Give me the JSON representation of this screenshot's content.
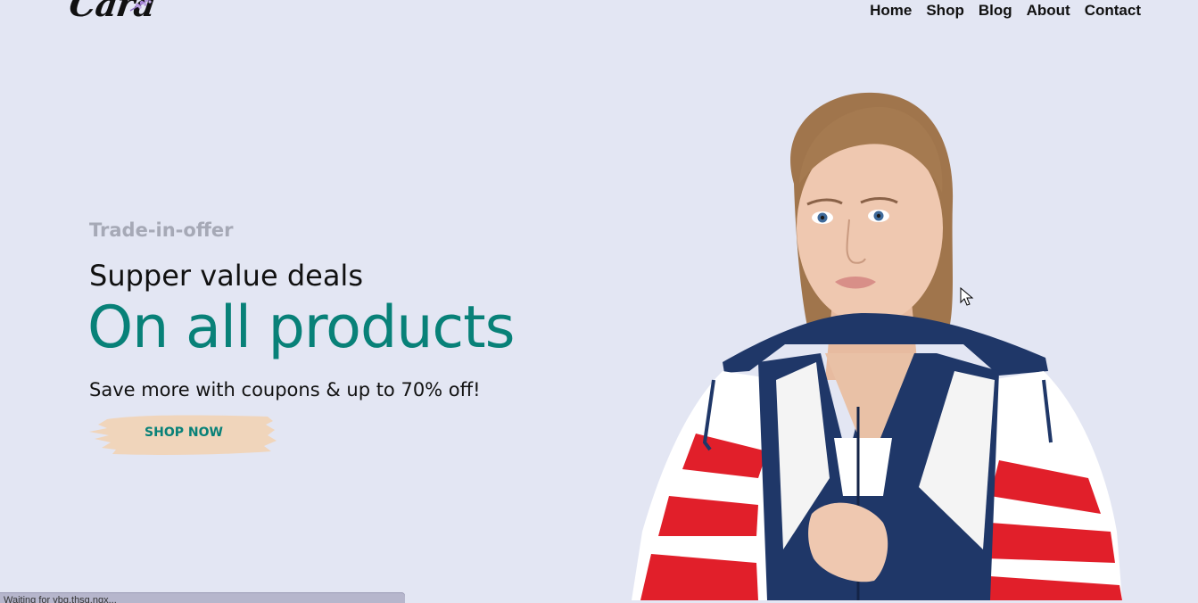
{
  "header": {
    "logo_text": "Cara",
    "nav": [
      "Home",
      "Shop",
      "Blog",
      "About",
      "Contact"
    ]
  },
  "hero": {
    "eyebrow": "Trade-in-offer",
    "headline": "Supper value deals",
    "title": "On all products",
    "subtitle": "Save more with coupons & up to 70% off!",
    "button_label": "SHOP NOW"
  },
  "status_bar": {
    "text": "Waiting for vbg.thsg.ngx..."
  },
  "colors": {
    "background": "#e3e6f3",
    "accent": "#088178",
    "muted": "#a6a9b6",
    "button_bg": "#f0d5bb"
  }
}
